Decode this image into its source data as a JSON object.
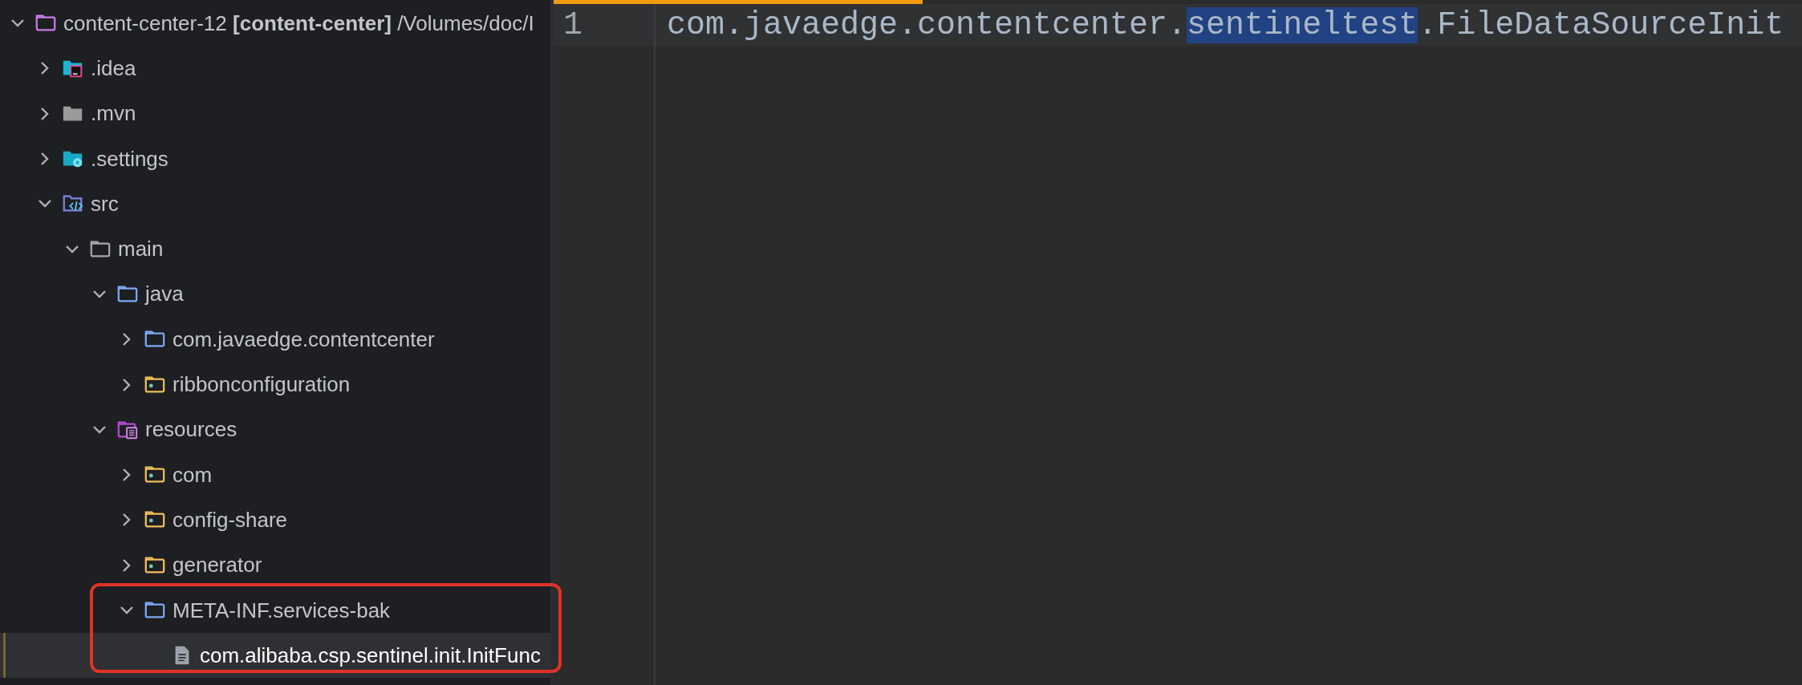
{
  "project_tree": {
    "items": [
      {
        "label": "content-center-12 **[content-center]** /Volumes/doc/I",
        "kind": "module",
        "expanded": true,
        "selected": false,
        "children": [
          {
            "label": ".idea",
            "kind": "idea",
            "expanded": false,
            "selected": false
          },
          {
            "label": ".mvn",
            "kind": "filled",
            "expanded": false,
            "selected": false
          },
          {
            "label": ".settings",
            "kind": "settings",
            "expanded": false,
            "selected": false
          },
          {
            "label": "src",
            "kind": "source",
            "expanded": true,
            "selected": false,
            "children": [
              {
                "label": "main",
                "kind": "plain",
                "expanded": true,
                "selected": false,
                "children": [
                  {
                    "label": "java",
                    "kind": "java",
                    "expanded": true,
                    "selected": false,
                    "children": [
                      {
                        "label": "com.javaedge.contentcenter",
                        "kind": "java",
                        "expanded": false,
                        "selected": false
                      },
                      {
                        "label": "ribbonconfiguration",
                        "kind": "package",
                        "expanded": false,
                        "selected": false
                      }
                    ]
                  },
                  {
                    "label": "resources",
                    "kind": "resources",
                    "expanded": true,
                    "selected": false,
                    "children": [
                      {
                        "label": "com",
                        "kind": "package",
                        "expanded": false,
                        "selected": false
                      },
                      {
                        "label": "config-share",
                        "kind": "package",
                        "expanded": false,
                        "selected": false
                      },
                      {
                        "label": "generator",
                        "kind": "package",
                        "expanded": false,
                        "selected": false
                      },
                      {
                        "label": "META-INF.services-bak",
                        "kind": "java",
                        "expanded": true,
                        "selected": false,
                        "highlighted": true,
                        "children": [
                          {
                            "label": "com.alibaba.csp.sentinel.init.InitFunc",
                            "kind": "file",
                            "selected": true
                          }
                        ]
                      }
                    ]
                  }
                ]
              }
            ]
          }
        ]
      }
    ]
  },
  "editor": {
    "lines": [
      {
        "number": "1",
        "current": true,
        "segments": [
          {
            "text": "com.javaedge.contentcenter.",
            "selected": false
          },
          {
            "text": "sentineltest",
            "selected": true
          },
          {
            "text": ".FileDataSourceInit",
            "selected": false
          }
        ]
      }
    ]
  }
}
